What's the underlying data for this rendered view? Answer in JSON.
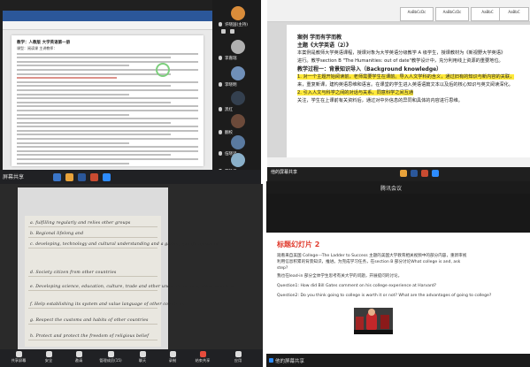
{
  "panel1": {
    "doc_title": "教学：人教版 大学英语第一册",
    "doc_subtitle": "课型：阅读课  主讲教师：",
    "share_label": "屏幕共享",
    "participants": [
      {
        "name": "许晓国(主持)",
        "color": "#d98c3a"
      },
      {
        "name": "李嘉瑞",
        "color": "#b0b0b0"
      },
      {
        "name": "李晓明",
        "color": "#6f8fb8"
      },
      {
        "name": "黑红",
        "color": "#34404f"
      },
      {
        "name": "翻校",
        "color": "#6c4a3a"
      },
      {
        "name": "伍晓鸿",
        "color": "#5a7aa0"
      },
      {
        "name": "范静华",
        "color": "#8ab0c9"
      }
    ]
  },
  "panel2": {
    "styles": [
      "AaBbCcDc",
      "AaBbCcDc",
      "AaBbC",
      "AaBbC"
    ],
    "lines": [
      {
        "text": "案例   学而有学而教",
        "bold": true
      },
      {
        "text": "主题《大学英语（2）》",
        "bold": true
      },
      {
        "text": "   本案例是教师大学英语课程，授课对象为大学英语分级教学 A 级学生，授课教材为《新视野大学英语》",
        "bold": false
      },
      {
        "text": "进行。教学section B \"The Humanities: out of date\"教学设计中，充分利用线上资源的重要地位。",
        "bold": false
      },
      {
        "text": "教学过程一：背景知识导入（Background knowledge）",
        "bold": true
      },
      {
        "text": "   1. 对一个主题开始阅读前，老师需要学生在课前。导入人文学科的含义，通过旧有的知识与新内容的关联，",
        "bold": false,
        "hl": "导入人文学科的含义"
      },
      {
        "text": "来，重复新课，建构英语思维和语言。在课堂的学生进入英语语篇文本以及后的核心知识与英文阅读深化。",
        "bold": false
      },
      {
        "text": "   2. 引入人文与科学之间的对话与关系，同意科学之间互通",
        "bold": false,
        "hl": "与科学技术的关系"
      },
      {
        "text": "   关注，学生在上课前有关资料后，通过对中外信息的异同和具体的内容进行思维。",
        "bold": false
      }
    ],
    "bottom_label": "他的屏幕共享"
  },
  "panel3": {
    "handwriting": [
      "a. fulfilling regularly and relies other groups",
      "b. Regional lifelong and",
      "c. developing, technology and cultural understanding and a global, qualifying scene",
      "d. Society citizen from other countries",
      "e. Developing science, education, culture, trade and other understanding of other countries",
      "f. Help establishing its system and value language of other countries",
      "g. Respect the customs and habits of other countries",
      "h. Protect and protect the freedom of religious belief"
    ],
    "controls": [
      "共享屏幕",
      "安全",
      "邀请",
      "管理成员(15)",
      "聊天",
      "录制",
      "结束共享",
      "应用"
    ]
  },
  "panel4": {
    "window_title": "腾讯会议",
    "slide_title": "标题幻灯片 2",
    "text_lines": [
      "观看来自美国 College---The Ladder to Success 主题的美国大学教育相关视频中的部分内容，重新审视",
      "利用信息积累的背景知识，推进。为完成学习任务，在section B 部分讨论What college is and, ask",
      "step?",
      "我也在lead-in 部分全体学生思考有关大学的问题，开展提问的讨论。",
      "Question1: How did Bill Gates comment on his college experience at Harvard?",
      "Question2: Do you think going to college is worth it or not? What are the advantages of going to college?"
    ],
    "bottom_label": "他的屏幕共享"
  }
}
